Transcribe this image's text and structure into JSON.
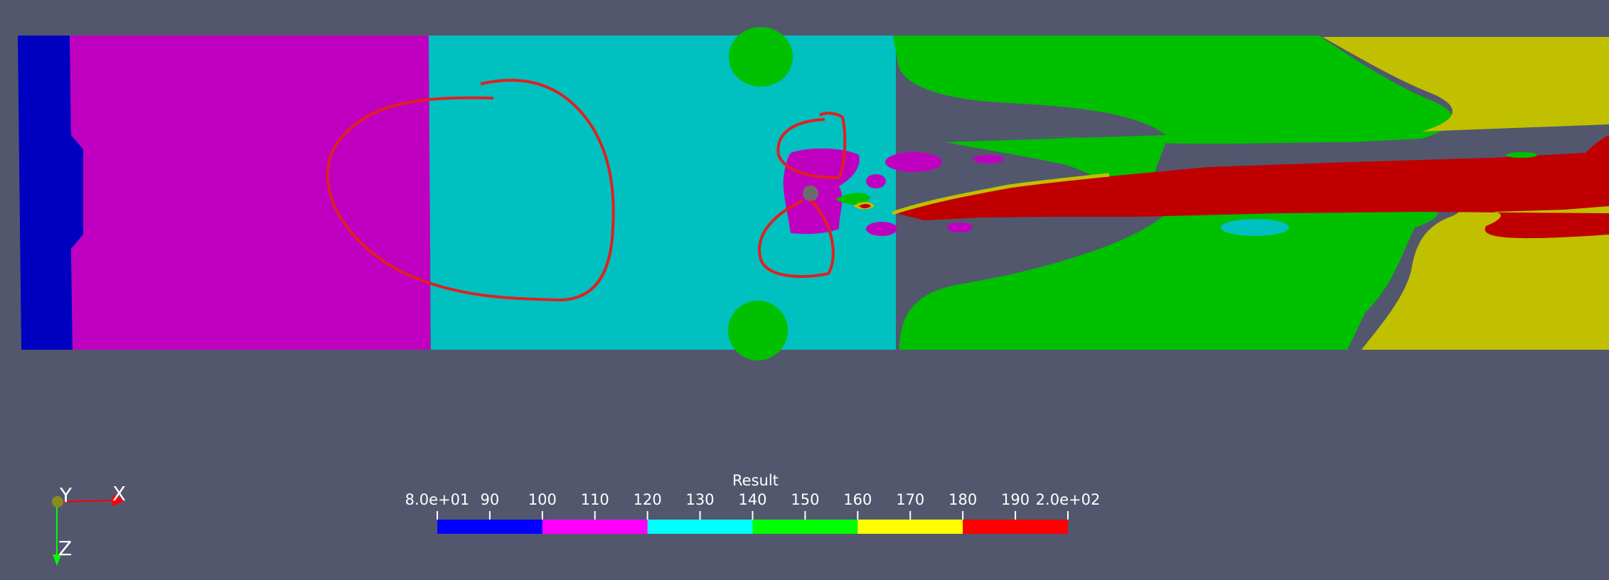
{
  "viewer": {
    "background_color": "#52576e"
  },
  "scalar_bar": {
    "title": "Result",
    "ticks": [
      {
        "value": 80,
        "label": "8.0e+01"
      },
      {
        "value": 90,
        "label": "90"
      },
      {
        "value": 100,
        "label": "100"
      },
      {
        "value": 110,
        "label": "110"
      },
      {
        "value": 120,
        "label": "120"
      },
      {
        "value": 130,
        "label": "130"
      },
      {
        "value": 140,
        "label": "140"
      },
      {
        "value": 150,
        "label": "150"
      },
      {
        "value": 160,
        "label": "160"
      },
      {
        "value": 170,
        "label": "170"
      },
      {
        "value": 180,
        "label": "180"
      },
      {
        "value": 190,
        "label": "190"
      },
      {
        "value": 200,
        "label": "2.0e+02"
      }
    ],
    "range": [
      80,
      200
    ],
    "bands": [
      {
        "from": 80,
        "to": 100,
        "color": "#0000ff"
      },
      {
        "from": 100,
        "to": 120,
        "color": "#ff00ff"
      },
      {
        "from": 120,
        "to": 140,
        "color": "#00ffff"
      },
      {
        "from": 140,
        "to": 160,
        "color": "#00ff00"
      },
      {
        "from": 160,
        "to": 180,
        "color": "#ffff00"
      },
      {
        "from": 180,
        "to": 200,
        "color": "#ff0000"
      }
    ]
  },
  "orientation_axes": {
    "y_label": "Y",
    "x_label": "X",
    "z_label": "Z",
    "x_color": "#ff0000",
    "y_color": "#c8c800",
    "z_color": "#00ff00"
  },
  "contour_colors": {
    "blue": "#0000c0",
    "magenta": "#c000c0",
    "cyan": "#00c0c0",
    "green": "#00c000",
    "yellow": "#c0c000",
    "red": "#c00000",
    "annotation": "#e02020"
  }
}
